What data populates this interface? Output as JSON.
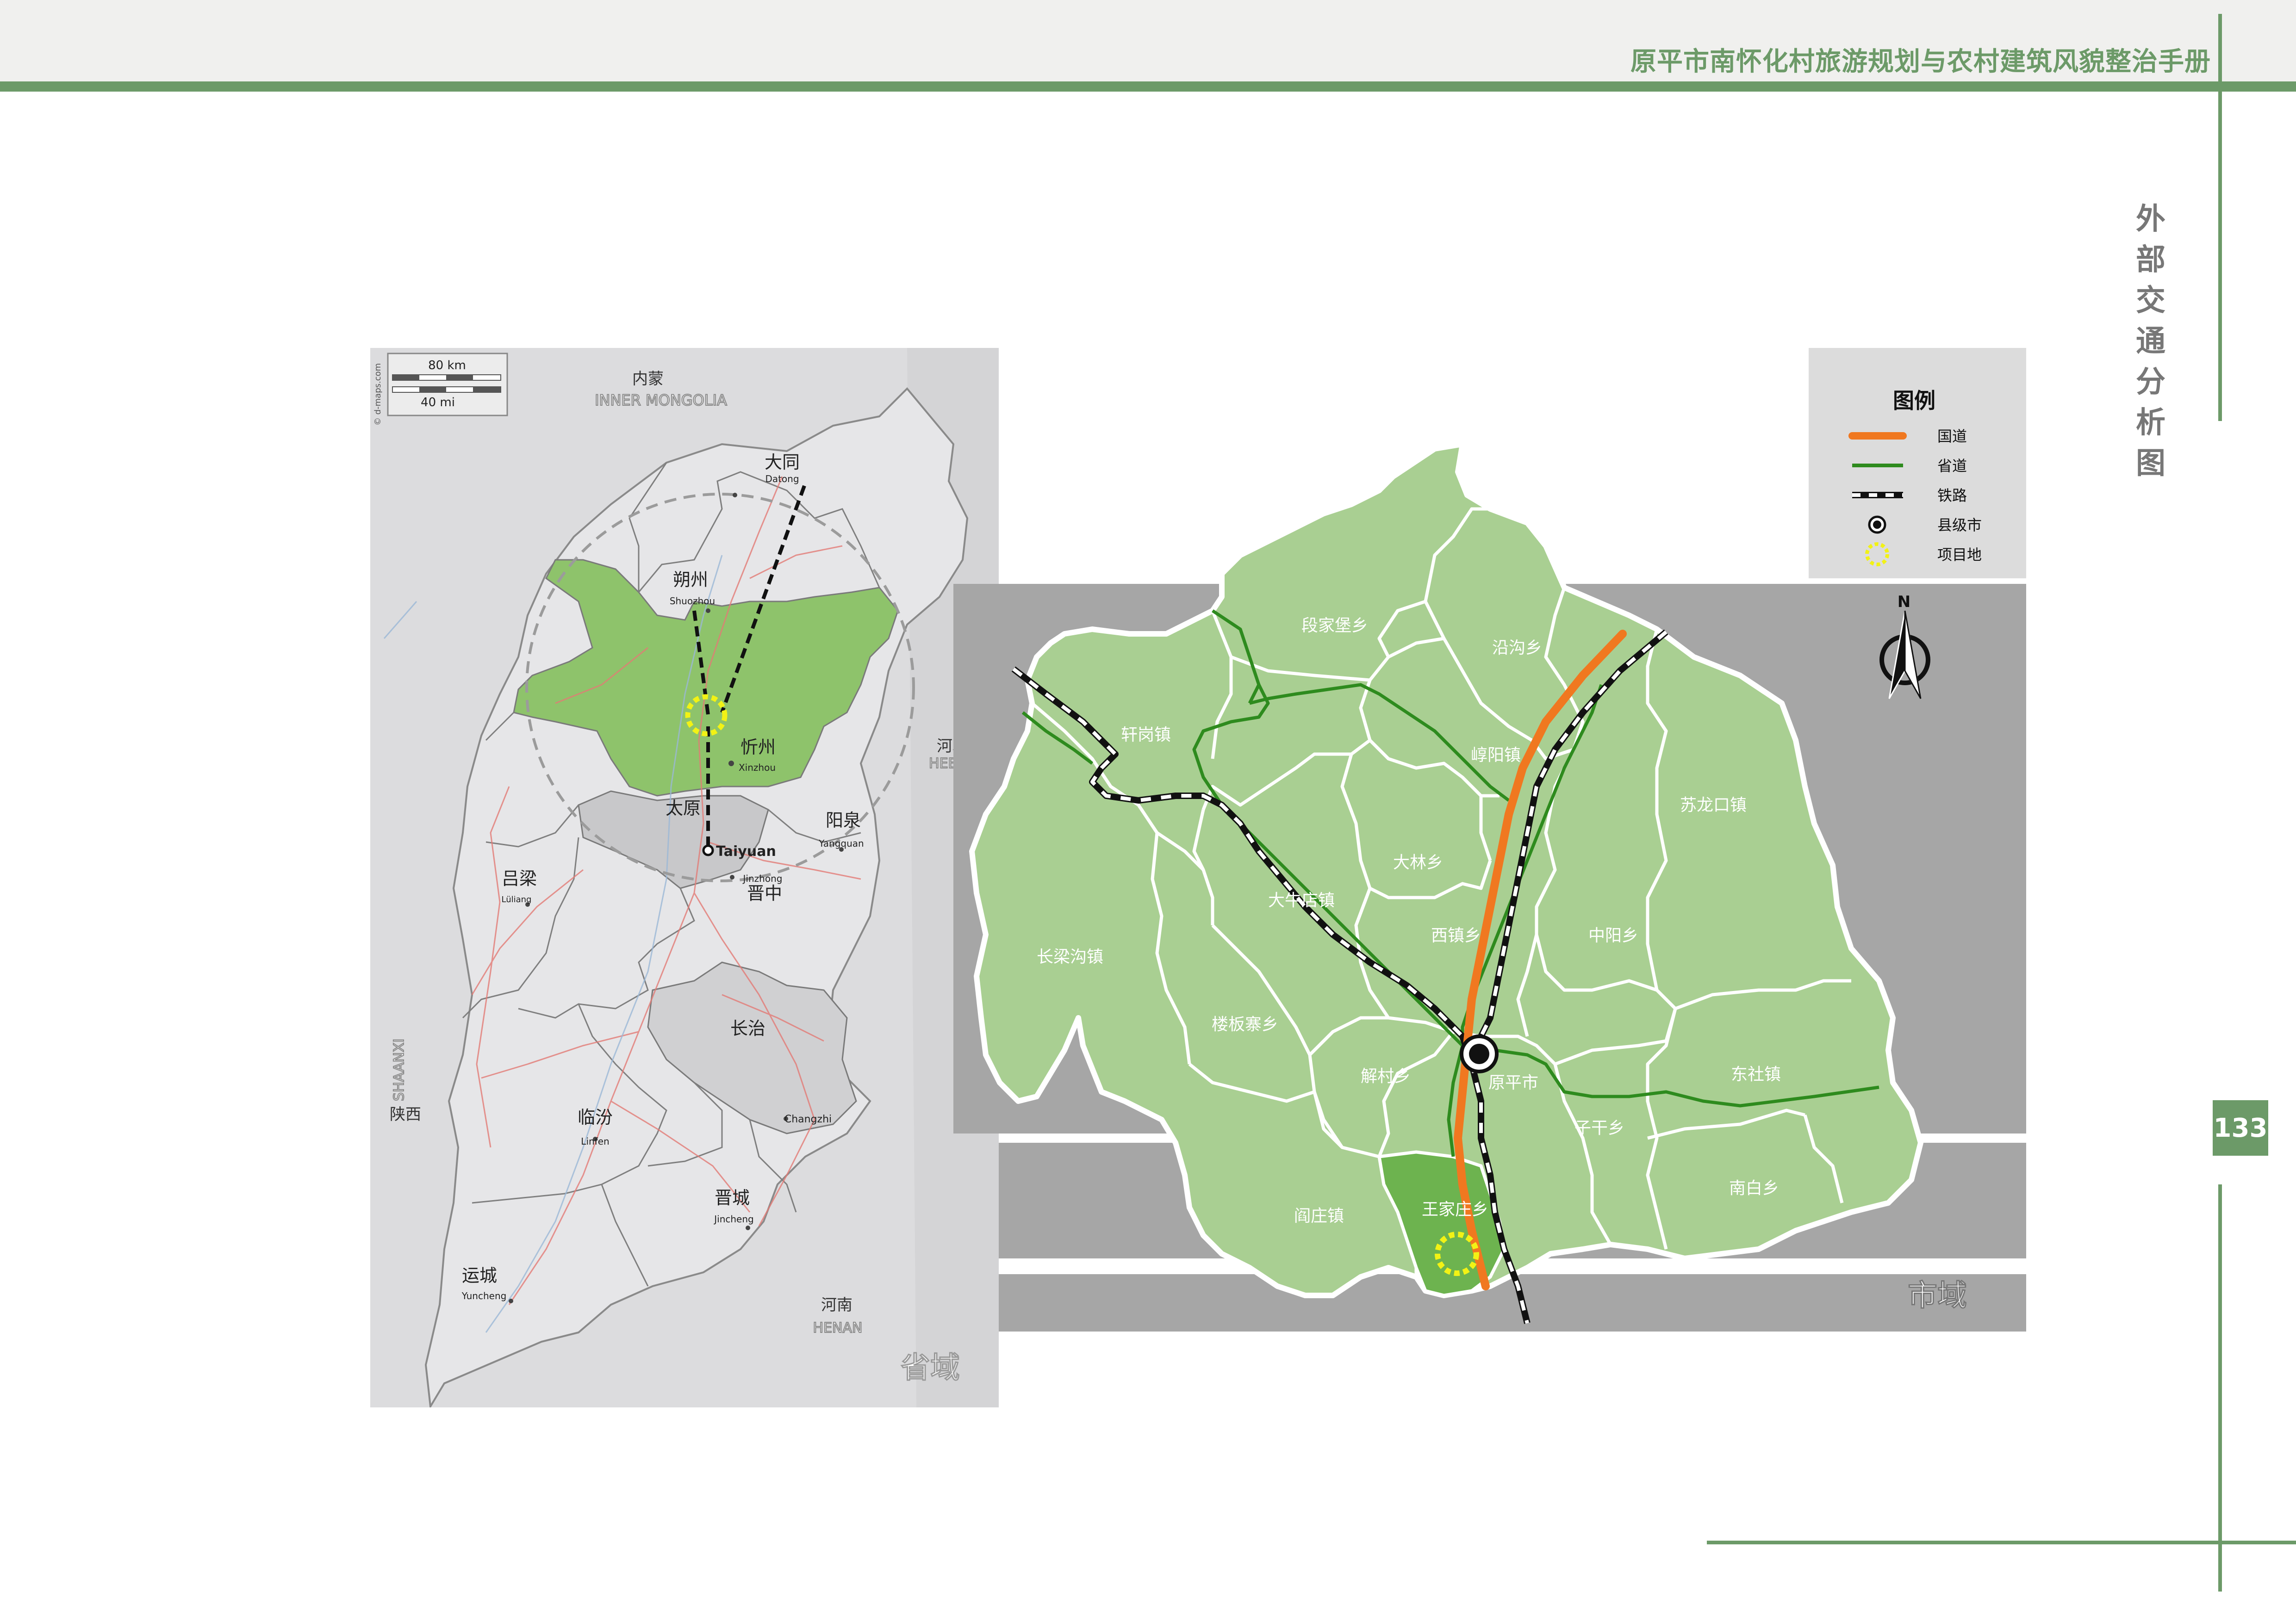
{
  "header": {
    "title": "原平市南怀化村旅游规划与农村建筑风貌整治手册"
  },
  "side_title": [
    "外",
    "部",
    "交",
    "通",
    "分",
    "析",
    "图"
  ],
  "page_number": "133",
  "province_map": {
    "section_label": "省域",
    "credit": "© d-maps.com",
    "scale_km": "80 km",
    "scale_mi": "40 mi",
    "neighbors": {
      "inner_mongolia_cn": "内蒙",
      "inner_mongolia_en": "INNER MONGOLIA",
      "hebei_cn": "河北",
      "hebei_en": "HEBEI",
      "henan_cn": "河南",
      "henan_en": "HENAN",
      "shaanxi_cn": "陕西",
      "shaanxi_en": "SHAANXI"
    },
    "cities": {
      "datong_cn": "大同",
      "datong_en": "Datong",
      "shuozhou_cn": "朔州",
      "shuozhou_en": "Shuozhou",
      "xinzhou_cn": "忻州",
      "xinzhou_en": "Xinzhou",
      "taiyuan_cn": "太原",
      "taiyuan_en": "Taiyuan",
      "yangquan_cn": "阳泉",
      "yangquan_en": "Yangquan",
      "lvliang_cn": "吕梁",
      "lvliang_en": "Lüliang",
      "jinzhong_cn": "晋中",
      "jinzhong_en": "Jinzhong",
      "changzhi_cn": "长治",
      "changzhi_en": "Changzhi",
      "linfen_cn": "临汾",
      "linfen_en": "Linfen",
      "jincheng_cn": "晋城",
      "jincheng_en": "Jincheng",
      "yuncheng_cn": "运城",
      "yuncheng_en": "Yuncheng"
    }
  },
  "county_map": {
    "section_label": "市域",
    "north_label": "N",
    "towns": {
      "duanjiabao": "段家堡乡",
      "yangou": "沿沟乡",
      "xuangang": "轩岗镇",
      "guoyang": "崞阳镇",
      "sulongkou": "苏龙口镇",
      "changlianggou": "长梁沟镇",
      "dalin": "大林乡",
      "daniudian": "大牛店镇",
      "xizhen": "西镇乡",
      "zhongyang": "中阳乡",
      "loubanzhai": "楼板寨乡",
      "jiecun": "解村乡",
      "yuanping": "原平市",
      "dongshe": "东社镇",
      "zigan": "子干乡",
      "wangjiazhuang": "王家庄乡",
      "yanzhuang": "阎庄镇",
      "nanbai": "南白乡"
    }
  },
  "legend": {
    "title": "图例",
    "items": [
      {
        "label": "国道",
        "symbol": "orange-line",
        "color": "#f07820"
      },
      {
        "label": "省道",
        "symbol": "green-line",
        "color": "#2e8b1e"
      },
      {
        "label": "铁路",
        "symbol": "railway-line",
        "color": "#111111"
      },
      {
        "label": "县级市",
        "symbol": "city-dot",
        "color": "#111111"
      },
      {
        "label": "项目地",
        "symbol": "project-ring",
        "color": "#f2f215"
      }
    ]
  },
  "colors": {
    "accent": "#6c9a68",
    "national_road": "#f07820",
    "provincial_road": "#2e8b1e",
    "county_fill": "#a9cf92",
    "highlight_fill": "#6db34f",
    "province_gray": "#e6e6e8",
    "outside_gray": "#a6a6a6"
  }
}
